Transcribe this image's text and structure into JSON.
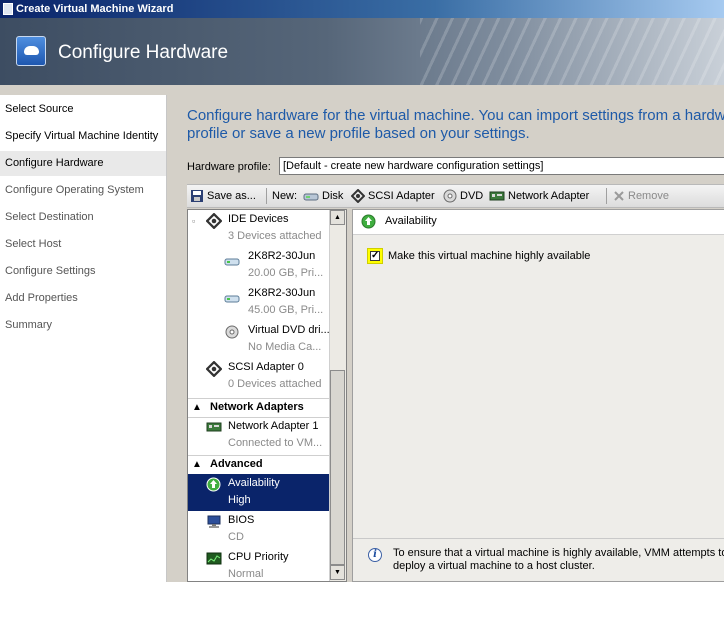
{
  "window": {
    "title": "Create Virtual Machine Wizard"
  },
  "header": {
    "title": "Configure Hardware"
  },
  "sidebar": {
    "steps": [
      {
        "label": "Select Source"
      },
      {
        "label": "Specify Virtual Machine Identity"
      },
      {
        "label": "Configure Hardware"
      },
      {
        "label": "Configure Operating System"
      },
      {
        "label": "Select Destination"
      },
      {
        "label": "Select Host"
      },
      {
        "label": "Configure Settings"
      },
      {
        "label": "Add Properties"
      },
      {
        "label": "Summary"
      }
    ],
    "current": "Configure Hardware"
  },
  "main": {
    "instructions_line1": "Configure hardware for the virtual machine. You can import settings from a hardware",
    "instructions_line2": "profile or save a new profile based on your settings.",
    "hardware_profile_label": "Hardware profile:",
    "hardware_profile_value": "[Default - create new hardware configuration settings]"
  },
  "toolbar": {
    "save_as": "Save as...",
    "new_label": "New:",
    "disk": "Disk",
    "scsi_adapter": "SCSI Adapter",
    "dvd": "DVD",
    "network_adapter": "Network Adapter",
    "remove": "Remove"
  },
  "tree": {
    "ide_devices": {
      "title": "IDE Devices",
      "sub": "3 Devices attached"
    },
    "disk1": {
      "title": "2K8R2-30Jun",
      "sub": "20.00 GB, Pri..."
    },
    "disk2": {
      "title": "2K8R2-30Jun",
      "sub": "45.00 GB, Pri..."
    },
    "dvd": {
      "title": "Virtual DVD dri...",
      "sub": "No Media Ca..."
    },
    "scsi": {
      "title": "SCSI Adapter 0",
      "sub": "0 Devices attached"
    },
    "network_header": "Network Adapters",
    "network1": {
      "title": "Network Adapter 1",
      "sub": "Connected to VM..."
    },
    "advanced_header": "Advanced",
    "availability": {
      "title": "Availability",
      "sub": "High"
    },
    "bios": {
      "title": "BIOS",
      "sub": "CD"
    },
    "cpu_priority": {
      "title": "CPU Priority",
      "sub": "Normal"
    }
  },
  "details": {
    "title": "Availability",
    "checkbox_label": "Make this virtual machine highly available",
    "checkbox_checked": true,
    "info_text": "To ensure that a virtual machine is highly available, VMM attempts to deploy a virtual machine to a host cluster."
  }
}
